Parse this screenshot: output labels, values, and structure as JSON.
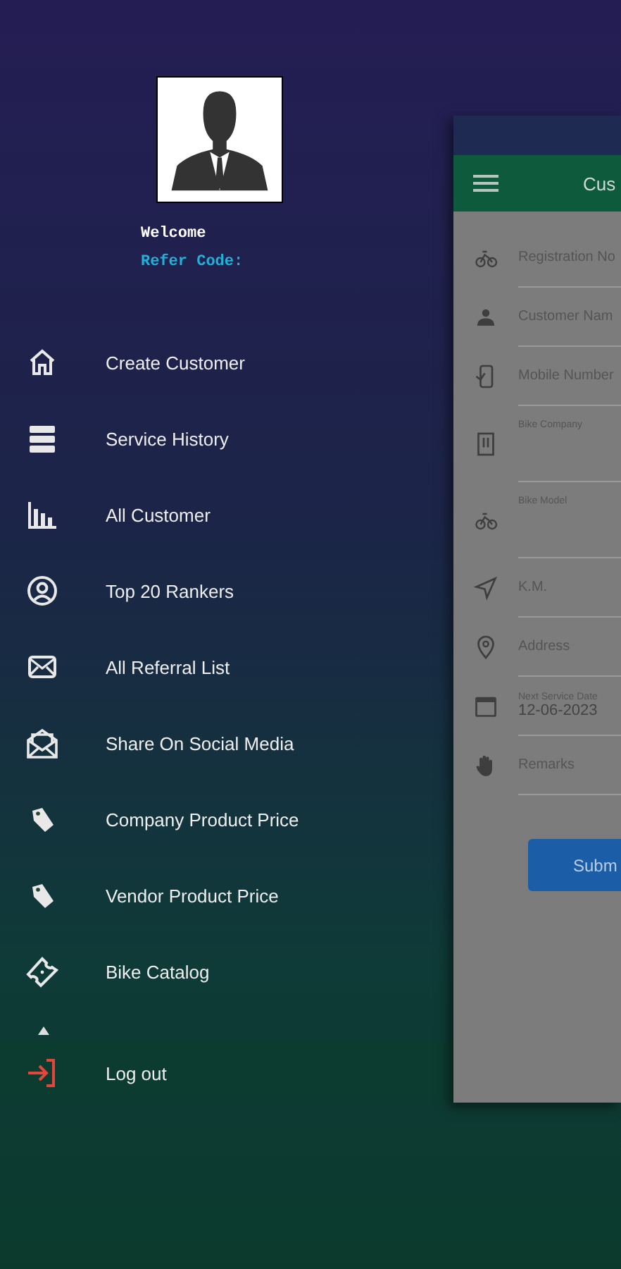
{
  "drawer": {
    "greeting": "Welcome",
    "refer_code_label": "Refer Code:",
    "items": [
      {
        "label": "Create Customer"
      },
      {
        "label": "Service History"
      },
      {
        "label": "All Customer"
      },
      {
        "label": "Top 20 Rankers"
      },
      {
        "label": "All Referral List"
      },
      {
        "label": "Share On Social Media"
      },
      {
        "label": "Company Product Price"
      },
      {
        "label": "Vendor Product Price"
      },
      {
        "label": "Bike Catalog"
      }
    ],
    "logout": {
      "label": "Log out"
    }
  },
  "screen": {
    "title": "Cus",
    "fields": [
      {
        "kind": "text",
        "placeholder": "Registration No"
      },
      {
        "kind": "text",
        "placeholder": "Customer Nam"
      },
      {
        "kind": "text",
        "placeholder": "Mobile Number"
      },
      {
        "kind": "dropdown",
        "label": "Bike Company"
      },
      {
        "kind": "dropdown",
        "label": "Bike Model"
      },
      {
        "kind": "text",
        "placeholder": "K.M."
      },
      {
        "kind": "text",
        "placeholder": "Address"
      },
      {
        "kind": "date",
        "label": "Next Service Date",
        "value": "12-06-2023"
      },
      {
        "kind": "text",
        "placeholder": "Remarks"
      }
    ],
    "submit": "Subm"
  }
}
